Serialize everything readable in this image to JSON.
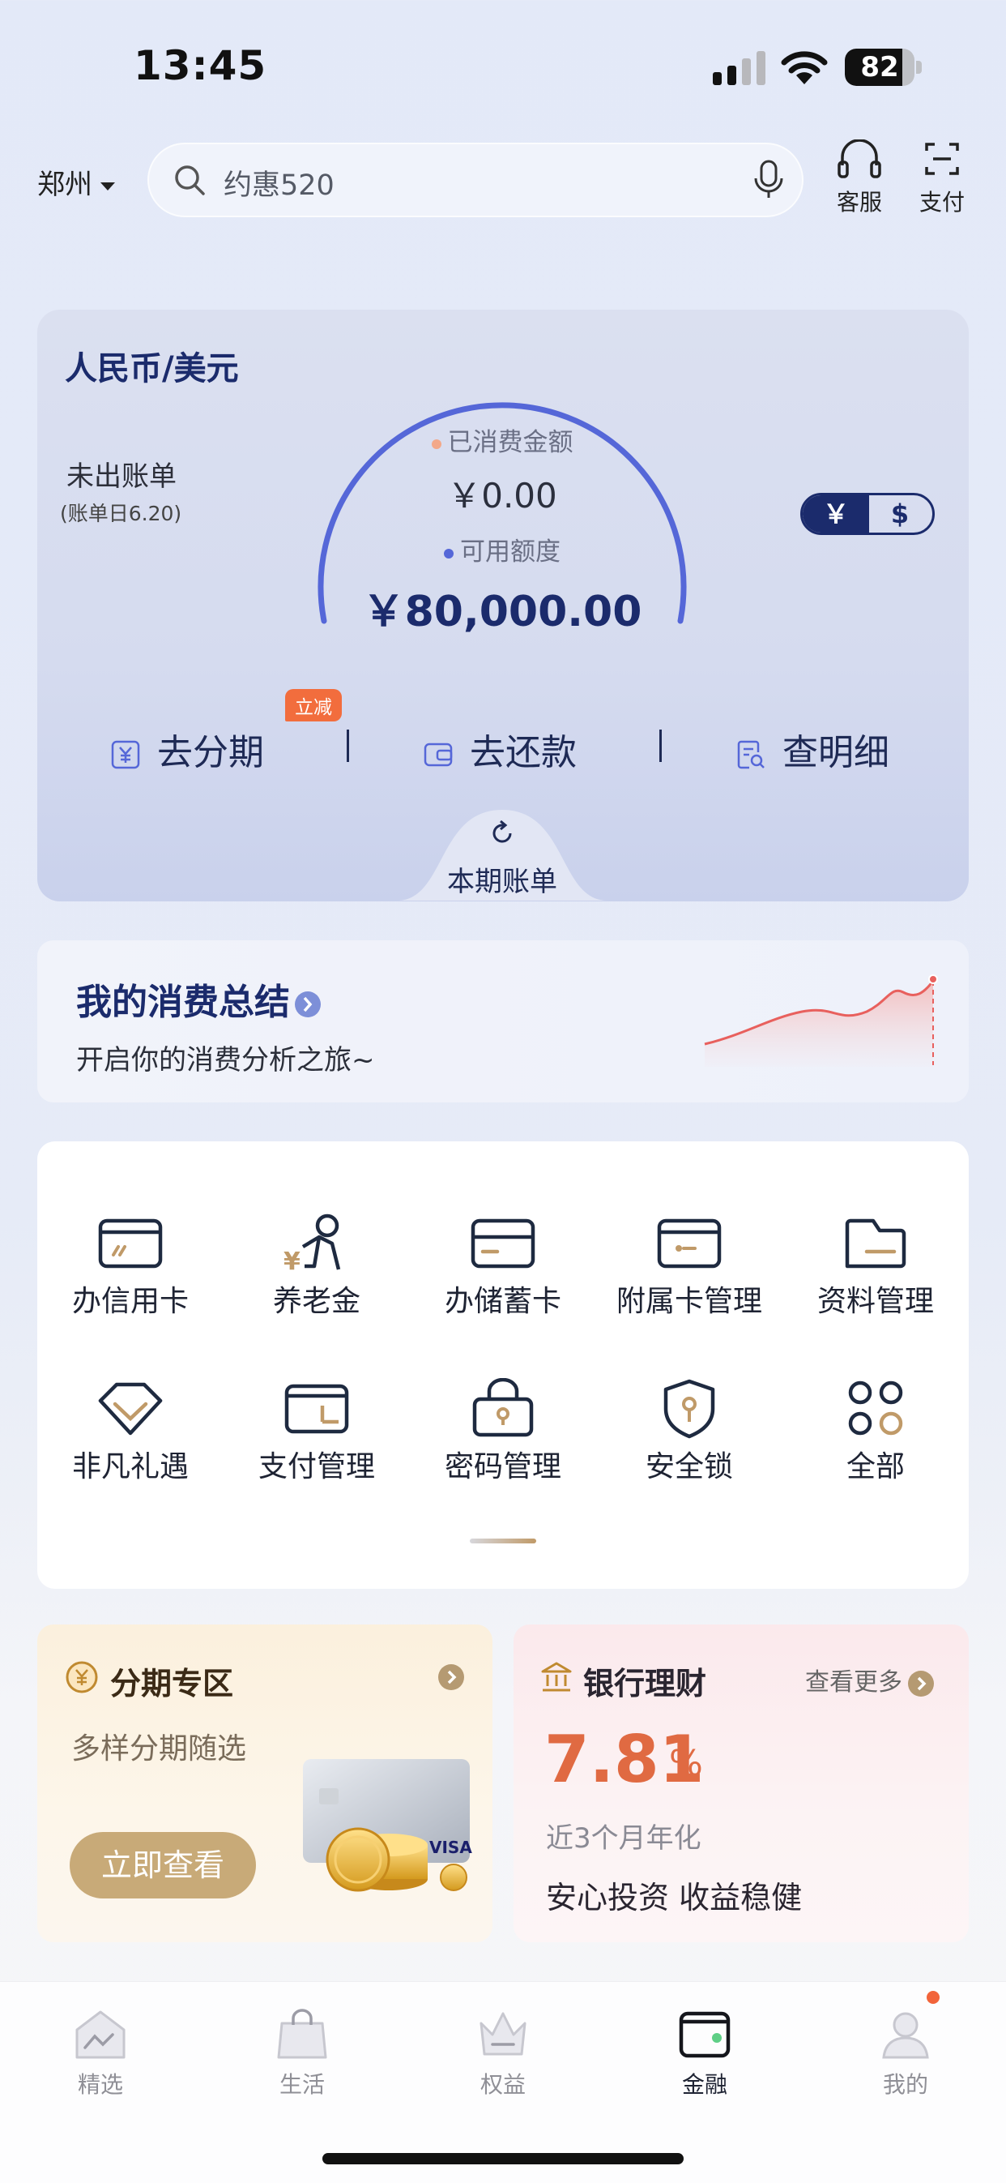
{
  "status_bar": {
    "time": "13:45",
    "battery": "82",
    "battery_level_percent": 82
  },
  "header": {
    "city": "郑州",
    "search_placeholder": "约惠520",
    "icons": [
      {
        "label": "客服",
        "icon": "headset-icon"
      },
      {
        "label": "支付",
        "icon": "scan-pay-icon"
      }
    ]
  },
  "credit_card": {
    "currency_title": "人民币/美元",
    "bill_status": "未出账单",
    "bill_date": "(账单日6.20)",
    "spent_label": "已消费金额",
    "spent_value": "￥0.00",
    "available_label": "可用额度",
    "available_value": "￥80,000.00",
    "currency_toggle": {
      "active": "￥",
      "inactive": "$"
    },
    "actions": [
      {
        "label": "去分期",
        "icon": "yuan-icon",
        "badge": "立减"
      },
      {
        "label": "去还款",
        "icon": "wallet-icon"
      },
      {
        "label": "查明细",
        "icon": "detail-search-icon"
      }
    ],
    "current_bill_label": "本期账单",
    "colors": {
      "accent": "#5567d8",
      "spent_dot": "#f3a889",
      "available_dot": "#5567d8",
      "navy": "#1b2b6c"
    }
  },
  "summary": {
    "title": "我的消费总结",
    "subtitle": "开启你的消费分析之旅~"
  },
  "grid": {
    "items": [
      {
        "label": "办信用卡",
        "icon": "credit-card-icon"
      },
      {
        "label": "养老金",
        "icon": "pension-icon"
      },
      {
        "label": "办储蓄卡",
        "icon": "debit-card-icon"
      },
      {
        "label": "附属卡管理",
        "icon": "supplementary-card-icon"
      },
      {
        "label": "资料管理",
        "icon": "folder-icon"
      },
      {
        "label": "非凡礼遇",
        "icon": "gift-diamond-icon"
      },
      {
        "label": "支付管理",
        "icon": "payment-wallet-icon"
      },
      {
        "label": "密码管理",
        "icon": "password-lock-icon"
      },
      {
        "label": "安全锁",
        "icon": "shield-key-icon"
      },
      {
        "label": "全部",
        "icon": "all-apps-icon"
      }
    ]
  },
  "installment": {
    "title": "分期专区",
    "subtitle": "多样分期随选",
    "button": "立即查看"
  },
  "wealth": {
    "title": "银行理财",
    "more": "查看更多",
    "rate": "7.81",
    "rate_unit": "%",
    "rate_desc": "近3个月年化",
    "slogan": "安心投资 收益稳健"
  },
  "tabbar": {
    "tabs": [
      {
        "label": "精选",
        "icon": "home-select-icon"
      },
      {
        "label": "生活",
        "icon": "shopping-bag-icon"
      },
      {
        "label": "权益",
        "icon": "crown-icon"
      },
      {
        "label": "金融",
        "icon": "finance-wallet-icon",
        "active": true
      },
      {
        "label": "我的",
        "icon": "profile-icon",
        "badge_dot": true
      }
    ]
  }
}
